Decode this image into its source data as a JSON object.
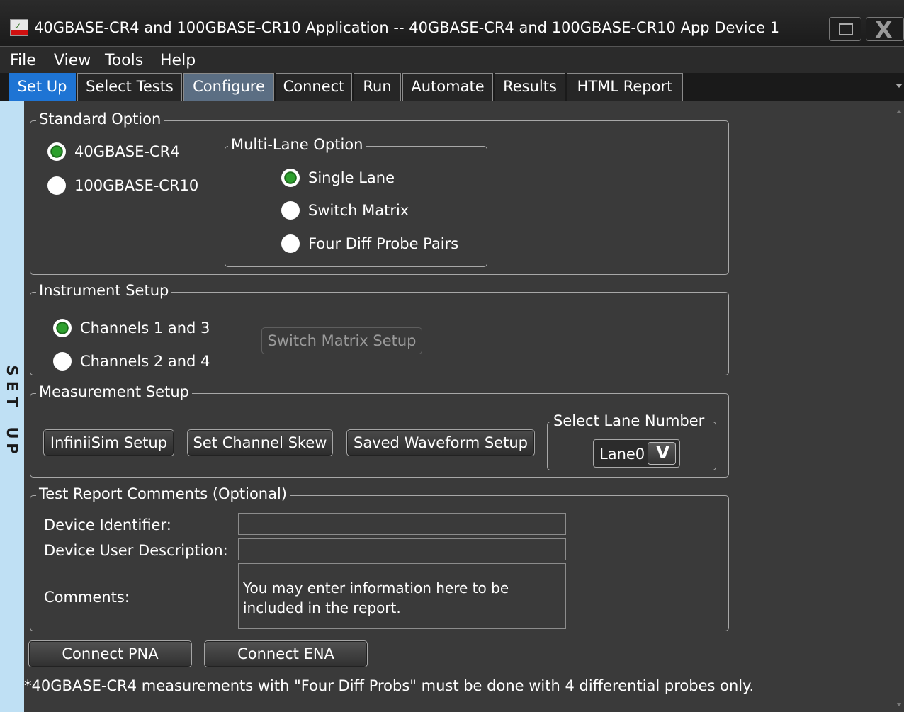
{
  "window": {
    "title": "40GBASE-CR4 and 100GBASE-CR10 Application -- 40GBASE-CR4 and 100GBASE-CR10 App Device 1",
    "app_icon": "app-icon",
    "maximize_icon": "maximize-icon",
    "close_icon": "close-icon",
    "close_glyph": "X"
  },
  "menu": [
    "File",
    "View",
    "Tools",
    "Help"
  ],
  "tabs": [
    "Set Up",
    "Select Tests",
    "Configure",
    "Connect",
    "Run",
    "Automate",
    "Results",
    "HTML Report"
  ],
  "active_tab": "Set Up",
  "side_tab_label": [
    "S",
    "E",
    "T",
    "",
    "U",
    "P"
  ],
  "standard_option": {
    "title": "Standard Option",
    "options": [
      "40GBASE-CR4",
      "100GBASE-CR10"
    ],
    "selected": "40GBASE-CR4"
  },
  "multi_lane_option": {
    "title": "Multi-Lane Option",
    "options": [
      "Single Lane",
      "Switch Matrix",
      "Four Diff Probe Pairs"
    ],
    "selected": "Single Lane"
  },
  "instrument_setup": {
    "title": "Instrument Setup",
    "options": [
      "Channels 1 and 3",
      "Channels 2 and 4"
    ],
    "selected": "Channels 1 and 3",
    "switch_matrix_button": "Switch Matrix Setup"
  },
  "measurement_setup": {
    "title": "Measurement Setup",
    "buttons": [
      "InfiniiSim Setup",
      "Set Channel Skew",
      "Saved Waveform Setup"
    ],
    "lane_group_title": "Select Lane Number",
    "lane_value": "Lane0",
    "lane_arrow_glyph": "V"
  },
  "test_report": {
    "title": "Test Report Comments (Optional)",
    "device_identifier_label": "Device Identifier:",
    "device_identifier_value": "",
    "device_user_description_label": "Device User Description:",
    "device_user_description_value": "",
    "comments_label": "Comments:",
    "comments_value": "You may enter information here to be included in the report."
  },
  "bottom_buttons": [
    "Connect PNA",
    "Connect ENA"
  ],
  "footnote": "*40GBASE-CR4 measurements with \"Four Diff Probs\" must be done with 4 differential probes only."
}
